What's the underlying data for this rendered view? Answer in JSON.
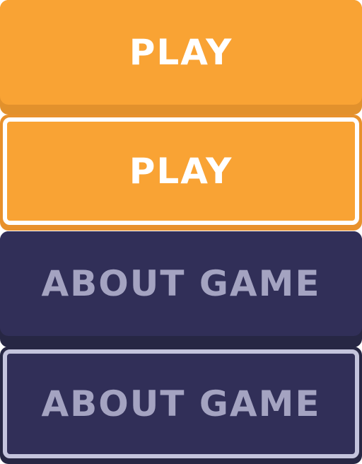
{
  "buttons": {
    "play_label": "PLAY",
    "play_highlighted_label": "PLAY",
    "about_label": "ABOUT GAME",
    "about_highlighted_label": "ABOUT GAME"
  },
  "colors": {
    "play_face": "#f9a334",
    "play_shadow": "#e2912c",
    "play_text": "#ffffff",
    "about_face": "#312f58",
    "about_shadow": "#272744",
    "about_text": "#a4a3c1",
    "highlight_border_play": "#ffffff",
    "highlight_border_about": "#c4c4dd"
  }
}
